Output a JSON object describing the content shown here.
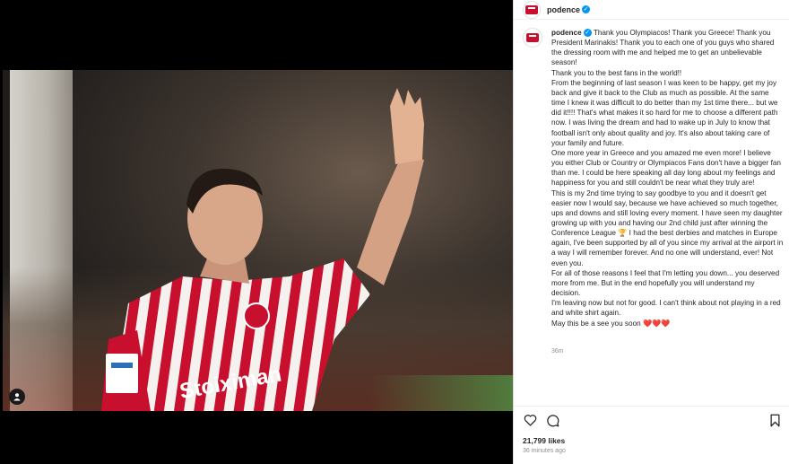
{
  "post": {
    "username": "podence",
    "verified": true,
    "caption_lines": [
      "Thank you Olympiacos! Thank you Greece! Thank you President Marinakis! Thank you to each one of you guys who shared the dressing room with me and helped me to get an unbelievable season!",
      "Thank you to the best fans in the world!!",
      "From the beginning of last season I was keen to be happy, get my joy back and give it back to the Club as much as possible. At the same time I knew it was difficult to do better than my 1st time there... but we did it!!!! That's what makes it so hard for me to choose a different path now. I was living the dream and had to wake up in July to know that football isn't only about quality and joy. It's also about taking care of your family and future.",
      "One more year in Greece and you amazed me even more! I believe you either Club or Country or Olympiacos Fans don't have a bigger fan than me. I could be here speaking all day long about my feelings and happiness for you and still couldn't be near what they truly are!",
      "This is my 2nd time trying to say goodbye to you and it doesn't get easier now I would say, because we have achieved so much together, ups and downs and still loving every moment. I have seen my daughter growing up with you and having our 2nd child just after winning the Conference League 🏆 I had the best derbies and matches in Europe again, I've been supported by all of you since my arrival at the airport in a way I will remember forever. And no one will understand, ever! Not even you.",
      "For all of those reasons I feel that I'm letting you down... you deserved more from me. But in the end hopefully you will understand my decision.",
      "I'm leaving now but not for good. I can't think about not playing in a red and white shirt again.",
      "May this be a see you soon ❤️❤️❤️"
    ],
    "caption_time": "36m",
    "likes": "21,799 likes",
    "posted_time": "36 minutes ago"
  },
  "icons": {
    "like": "heart-icon",
    "comment": "comment-icon",
    "save": "bookmark-icon",
    "tag": "user-tag-icon"
  },
  "colors": {
    "accent": "#0095f6",
    "kit_red": "#c8102e",
    "text": "#262626",
    "muted": "#8e8e8e"
  }
}
